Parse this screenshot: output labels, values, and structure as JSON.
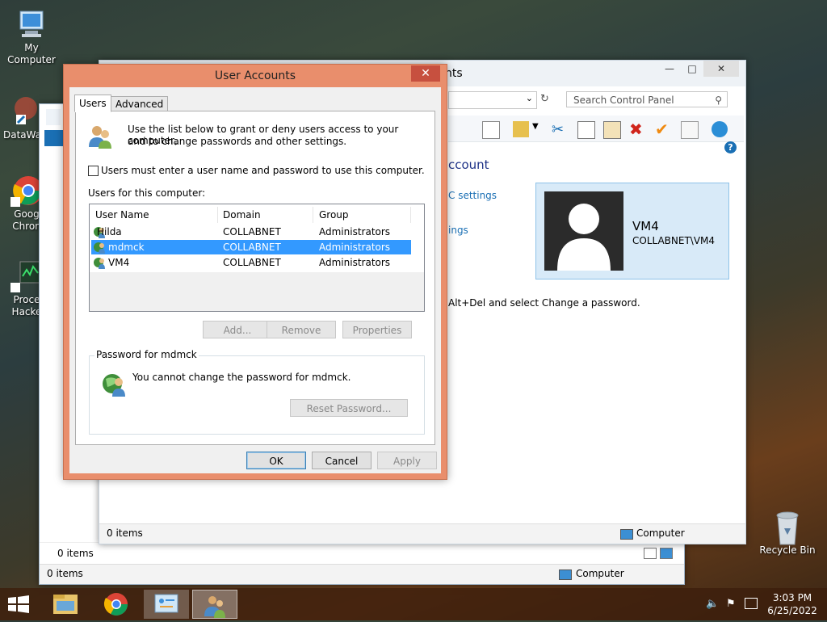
{
  "desktop": {
    "icons": [
      {
        "name": "my-computer",
        "label": "My Computer"
      },
      {
        "name": "datawag",
        "label": "DataWag"
      },
      {
        "name": "google-chrome",
        "label1": "Goog",
        "label2": "Chron"
      },
      {
        "name": "process-hacker",
        "label1": "Proce",
        "label2": "Hacke"
      },
      {
        "name": "recycle-bin",
        "label": "Recycle Bin"
      }
    ]
  },
  "back_window": {
    "items_count": "0 items",
    "status_location": "Computer",
    "left_items_count": "0 items"
  },
  "control_panel": {
    "title_partial": "nts",
    "search_placeholder": "Search Control Panel",
    "heading_partial": "ccount",
    "link1_partial": "C settings",
    "link2_partial": "ings",
    "change_password_hint": "Alt+Del and select Change a password.",
    "account_name": "VM4",
    "account_domain": "COLLABNET\\VM4",
    "status_items": "0 items",
    "status_location": "Computer",
    "help_glyph": "?"
  },
  "dialog": {
    "title": "User Accounts",
    "close_glyph": "✕",
    "tabs": [
      {
        "label": "Users",
        "active": true
      },
      {
        "label": "Advanced",
        "active": false
      }
    ],
    "intro_line1": "Use the list below to grant or deny users access to your computer,",
    "intro_line2": "and to change passwords and other settings.",
    "require_login_label": "Users must enter a user name and password to use this computer.",
    "require_login_checked": false,
    "users_for_computer_label": "Users for this computer:",
    "columns": [
      "User Name",
      "Domain",
      "Group"
    ],
    "rows": [
      {
        "user": "Hilda",
        "domain": "COLLABNET",
        "group": "Administrators",
        "selected": false
      },
      {
        "user": "mdmck",
        "domain": "COLLABNET",
        "group": "Administrators",
        "selected": true
      },
      {
        "user": "VM4",
        "domain": "COLLABNET",
        "group": "Administrators",
        "selected": false
      }
    ],
    "add_button": "Add...",
    "remove_button": "Remove",
    "properties_button": "Properties",
    "password_group_title": "Password for mdmck",
    "password_message": "You cannot change the password for mdmck.",
    "reset_password_button": "Reset Password...",
    "ok_button": "OK",
    "cancel_button": "Cancel",
    "apply_button": "Apply"
  },
  "taskbar": {
    "clock_time": "3:03 PM",
    "clock_date": "6/25/2022"
  },
  "colors": {
    "dialog_border": "#e98e6c",
    "selection": "#3399ff",
    "link": "#1a6fb4"
  }
}
